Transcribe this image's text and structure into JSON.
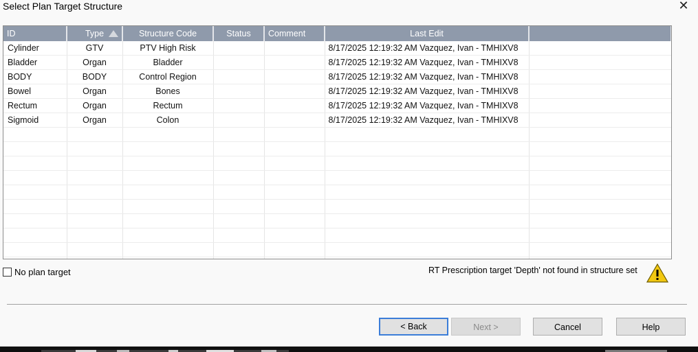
{
  "window": {
    "title": "Select Plan Target Structure",
    "close_glyph": "✕"
  },
  "grid": {
    "columns": [
      {
        "label": "ID",
        "align": "left"
      },
      {
        "label": "Type",
        "align": "center",
        "sorted": true
      },
      {
        "label": "Structure Code",
        "align": "center"
      },
      {
        "label": "Status",
        "align": "center"
      },
      {
        "label": "Comment",
        "align": "left"
      },
      {
        "label": "Last Edit",
        "align": "center"
      },
      {
        "label": "",
        "align": "center"
      }
    ],
    "rows": [
      {
        "id": "Cylinder",
        "type": "GTV",
        "code": "PTV High Risk",
        "status": "",
        "comment": "",
        "last_edit": "8/17/2025 12:19:32 AM Vazquez, Ivan - TMHIXV8"
      },
      {
        "id": "Bladder",
        "type": "Organ",
        "code": "Bladder",
        "status": "",
        "comment": "",
        "last_edit": "8/17/2025 12:19:32 AM Vazquez, Ivan - TMHIXV8"
      },
      {
        "id": "BODY",
        "type": "BODY",
        "code": "Control Region",
        "status": "",
        "comment": "",
        "last_edit": "8/17/2025 12:19:32 AM Vazquez, Ivan - TMHIXV8"
      },
      {
        "id": "Bowel",
        "type": "Organ",
        "code": "Bones",
        "status": "",
        "comment": "",
        "last_edit": "8/17/2025 12:19:32 AM Vazquez, Ivan - TMHIXV8"
      },
      {
        "id": "Rectum",
        "type": "Organ",
        "code": "Rectum",
        "status": "",
        "comment": "",
        "last_edit": "8/17/2025 12:19:32 AM Vazquez, Ivan - TMHIXV8"
      },
      {
        "id": "Sigmoid",
        "type": "Organ",
        "code": "Colon",
        "status": "",
        "comment": "",
        "last_edit": "8/17/2025 12:19:32 AM Vazquez, Ivan - TMHIXV8"
      }
    ]
  },
  "no_plan_target": {
    "label": "No plan target",
    "checked": false
  },
  "warning": {
    "text": "RT Prescription target 'Depth' not found in structure set",
    "icon": "warning-icon"
  },
  "buttons": {
    "back": "< Back",
    "next": "Next >",
    "cancel": "Cancel",
    "help": "Help"
  },
  "colors": {
    "header_bg": "#8f9aab",
    "accent": "#3b7dd8",
    "warning": "#f2c811"
  }
}
